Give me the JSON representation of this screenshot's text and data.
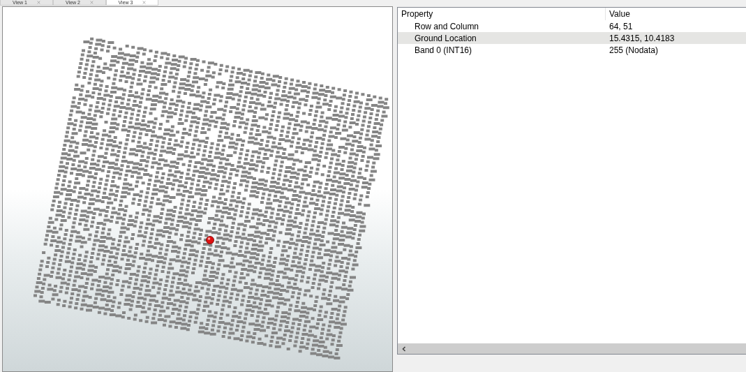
{
  "tabs": [
    {
      "label": "View 1",
      "selected": false
    },
    {
      "label": "View 2",
      "selected": false
    },
    {
      "label": "View 3",
      "selected": true
    }
  ],
  "property_grid": {
    "columns": [
      "Property",
      "Value"
    ],
    "rows": [
      {
        "property": "Row and Column",
        "value": "64, 51",
        "selected": false
      },
      {
        "property": "Ground Location",
        "value": "15.4315, 10.4183",
        "selected": true
      },
      {
        "property": "Band 0 (INT16)",
        "value": "255 (Nodata)",
        "selected": false
      }
    ]
  }
}
